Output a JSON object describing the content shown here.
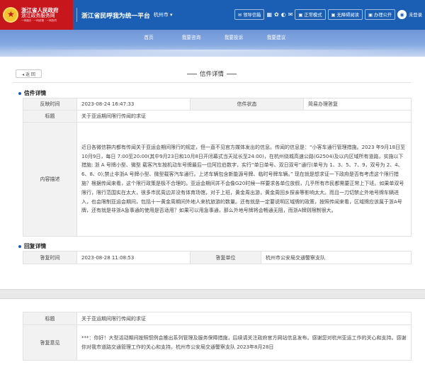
{
  "header": {
    "brand_line1": "浙江省人民政府",
    "brand_line2": "浙江政务服务网",
    "brand_line3": "一网通办 · 一网统管 · 一网协同",
    "site_title": "浙江省民呼我为统一平台",
    "city": "杭州市 ▾",
    "btn_letters": "✉ 领导信箱",
    "btn_standard": "▣ 正常模式",
    "btn_accessible": "▣ 无障碍阅读",
    "btn_online": "▣ 办理公开",
    "avatar_glyph": "◉",
    "username": "未登录"
  },
  "nav": {
    "items": [
      "首页",
      "我要咨询",
      "我要投诉",
      "我要建议"
    ]
  },
  "page": {
    "back_label": "◂ 返 回",
    "title": "信件详情"
  },
  "letter": {
    "section_title": "信件详情",
    "time_label": "反映时间",
    "time_value": "2023-08-24 16:47:33",
    "status_label": "信件状态",
    "status_value": "简易办理答复",
    "subject_label": "标题",
    "subject_value": "关于亚运期间限行传闻的求证",
    "content_label": "内容描述",
    "content_value": "近日各微信群内都有传闻关于亚运会期间限行的规定，但一直不见官方媒体发出的信息。传闻的信息是：“小客车通行管理措施。2023 年9月18日至10月9日，每日 7:00至20:00(其中9月23日和10月8日开闭幕式当天延长至24:00)，在杭州绕城高速公路(G2504)及以内区域所有道路，实施以下措施: 浙 A 号牌小型、微型 载客汽车按机动车号牌最后一位阿拉伯数字，实行“单日单号、双日双号”通行(单号为 1、3、5、7、9，双号为 2、4、6、8、0);禁止非浙A 号牌小型、微型载客汽车通行。上述车辆包含新能源号牌、临时号牌车辆。” 现在就是想求证一下政府是否有考虑这个限行措施？根据传闻来看，这个限行政策是极不合理的。亚运会期间并不会像G20时候一样要求各单位放假，几乎所有市民都需要正常上下班。如果单双号限行，限行范围实在太大，很多市民周边并没有体育场馆，对于上班，黄金周出游，黄金周回乡探亲等影响太大。而且一刀切禁止外地号牌车辆进入，也会限制亚运会期间，包括十一黄金周期间外地人来杭旅游的数量。还有就是一定要说明区域牌的政策，按照传闻来看，区域牌应该属于浙A号牌，还有就是非浙A急事通的使用是否适用？如果可以用急事通，那么外地号牌将会畅通无阻，而浙A牌则限制很大。"
  },
  "reply": {
    "section_title": "回复详情",
    "time_label": "答复时间",
    "time_value": "2023-08-28 11:08:53",
    "unit_label": "答复单位",
    "unit_value": "杭州市公安局交通警察支队",
    "subject_label": "标题",
    "subject_value": "关于亚运期间限行传闻的求证",
    "opinion_label": "答复意见",
    "opinion_value": "***：你好！大型活动期间按照惯例会推出系列管理及服务保障措施，后续请关注政府官方网站信息发布。感谢您对杭州亚运工作的关心和支持。感谢你对我市道路交通管理工作的关心和支持。杭州市公安局交通警察支队 2023年8月28日"
  }
}
